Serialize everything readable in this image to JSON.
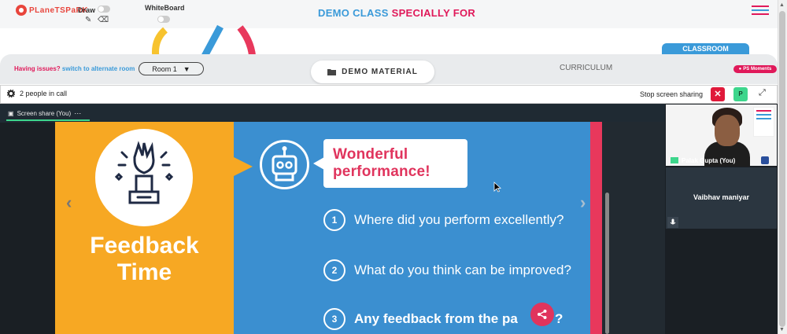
{
  "header": {
    "logo_text": "PLaneTSPaRK",
    "draw_label": "Draw",
    "whiteboard_label": "WhiteBoard",
    "title_part1": "DEMO CLASS",
    "title_part2": "SPECIALLY FOR"
  },
  "classroom_tab": "CLASSROOM",
  "toolbar": {
    "issues_text": "Having issues?",
    "alternate_room_link": "switch to alternate room",
    "room_selected": "Room 1",
    "demo_material_label": "DEMO MATERIAL",
    "curriculum_label": "CURRICULUM",
    "ps_moments_label": "PS Moments"
  },
  "call": {
    "people_count_text": "2 people in call",
    "stop_sharing_label": "Stop screen sharing",
    "p_button_label": "P",
    "screen_share_tab": "Screen share (You)"
  },
  "slide": {
    "left_title_line1": "Feedback",
    "left_title_line2": "Time",
    "heading_line1": "Wonderful",
    "heading_line2": "performance!",
    "questions": [
      {
        "num": "1",
        "text": "Where did you perform excellently?"
      },
      {
        "num": "2",
        "text": "What do you think can be improved?"
      },
      {
        "num": "3",
        "text": "Any feedback from the pa"
      }
    ],
    "q3_tail": "?"
  },
  "participants": [
    {
      "name": "Palak Gupta (You)"
    },
    {
      "name": "Vaibhav maniyar"
    }
  ],
  "colors": {
    "brand_red": "#e8453c",
    "accent_blue": "#3a9ad9",
    "accent_pink": "#e0195a",
    "slide_orange": "#f7a823",
    "slide_blue": "#3b8fd0",
    "green": "#3dd68c"
  }
}
